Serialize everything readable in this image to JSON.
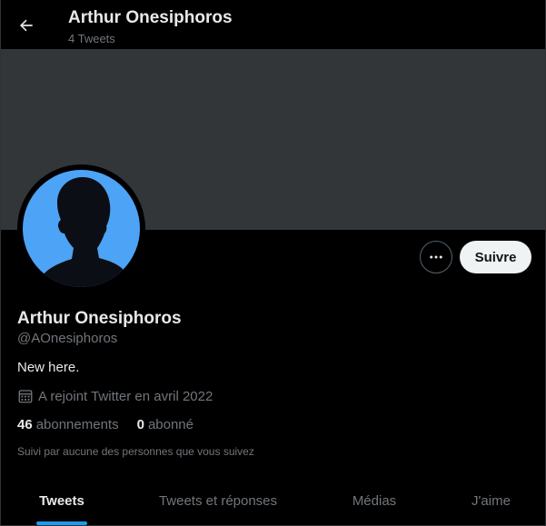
{
  "header": {
    "title": "Arthur Onesiphoros",
    "tweet_count": "4 Tweets"
  },
  "profile": {
    "name": "Arthur Onesiphoros",
    "handle": "@AOnesiphoros",
    "bio": "New here.",
    "joined": "A rejoint Twitter en avril 2022",
    "following_count": "46",
    "following_label": "abonnements",
    "followers_count": "0",
    "followers_label": "abonné",
    "followed_by": "Suivi par aucune des personnes que vous suivez"
  },
  "actions": {
    "follow_label": "Suivre"
  },
  "tabs": [
    {
      "label": "Tweets",
      "active": true
    },
    {
      "label": "Tweets et réponses",
      "active": false
    },
    {
      "label": "Médias",
      "active": false
    },
    {
      "label": "J'aime",
      "active": false
    }
  ],
  "colors": {
    "accent": "#1d9bf0",
    "banner": "#333639",
    "avatar_bg": "#4da3f5"
  },
  "icons": {
    "back": "arrow-left-icon",
    "more": "more-horizontal-icon",
    "calendar": "calendar-icon"
  }
}
